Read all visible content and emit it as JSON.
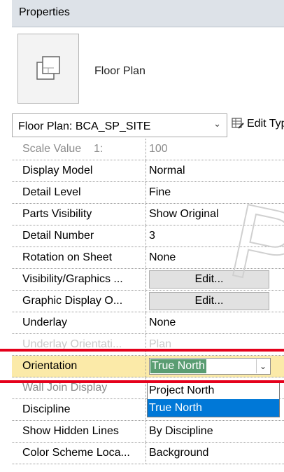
{
  "palette": {
    "panel_header": "#dde2e8",
    "highlight_row": "#fbeaa8",
    "highlight_line": "#e5001b",
    "dropdown_selected": "#0078d7",
    "value_selection": "#5a9d72"
  },
  "header": {
    "title": "Properties"
  },
  "type_preview": {
    "icon": "floor-plan-icon",
    "name": "Floor Plan"
  },
  "type_selector": {
    "value": "Floor Plan: BCA_SP_SITE",
    "edit_type_label": "Edit Typ",
    "edit_type_icon": "edit-type-icon"
  },
  "properties": [
    {
      "label": "Scale Value    1:",
      "value": "100"
    },
    {
      "label": "Display Model",
      "value": "Normal"
    },
    {
      "label": "Detail Level",
      "value": "Fine"
    },
    {
      "label": "Parts Visibility",
      "value": "Show Original"
    },
    {
      "label": "Detail Number",
      "value": "3"
    },
    {
      "label": "Rotation on Sheet",
      "value": "None"
    },
    {
      "label": "Visibility/Graphics ...",
      "value": "Edit..."
    },
    {
      "label": "Graphic Display O...",
      "value": "Edit..."
    },
    {
      "label": "Underlay",
      "value": "None"
    },
    {
      "label": "Underlay Orientati...",
      "value": "Plan"
    },
    {
      "label": "Orientation",
      "value": "True North"
    },
    {
      "label": "Wall Join Display",
      "value": ""
    },
    {
      "label": "Discipline",
      "value": ""
    },
    {
      "label": "Show Hidden Lines",
      "value": "By Discipline"
    },
    {
      "label": "Color Scheme Loca...",
      "value": "Background"
    }
  ],
  "orientation_dropdown": {
    "options": [
      "Project North",
      "True North"
    ],
    "selected": "True North"
  },
  "watermark": {
    "text": "P"
  }
}
